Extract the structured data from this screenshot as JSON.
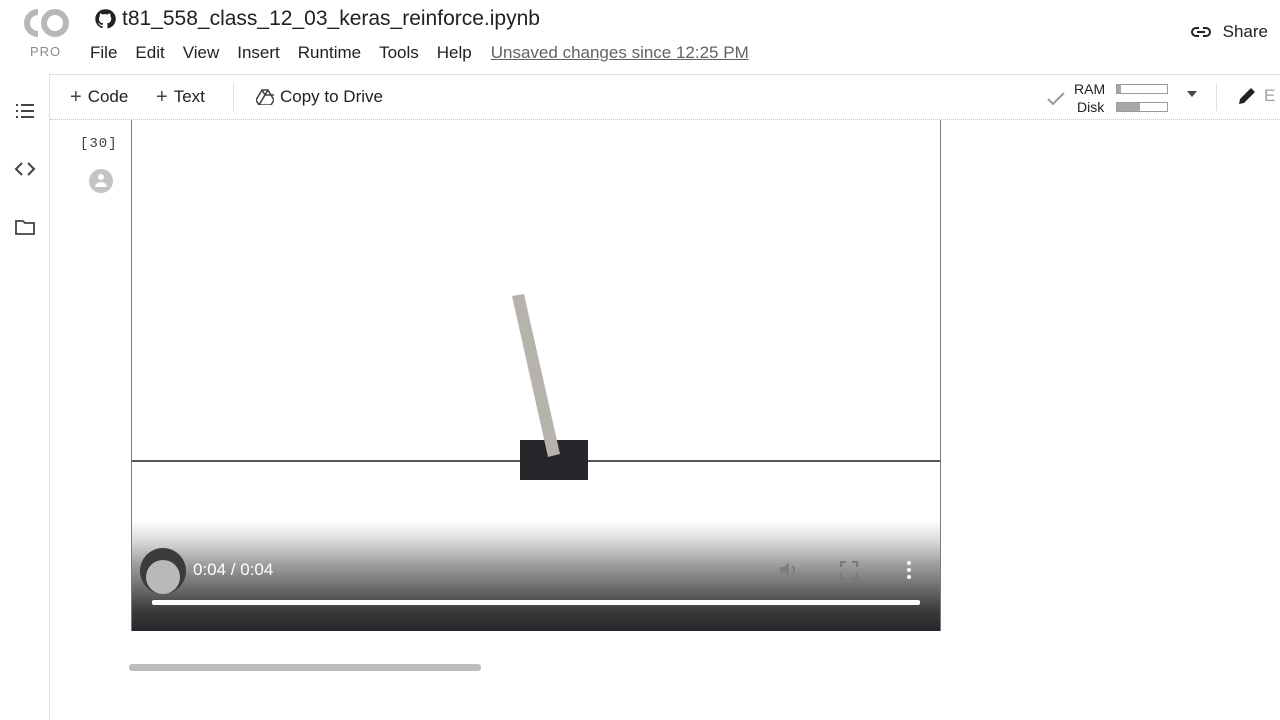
{
  "app": {
    "logo_text": "CO",
    "logo_badge": "PRO",
    "notebook_title": "t81_558_class_12_03_keras_reinforce.ipynb",
    "share_label": "Share"
  },
  "menu": {
    "items": [
      {
        "label": "File"
      },
      {
        "label": "Edit"
      },
      {
        "label": "View"
      },
      {
        "label": "Insert"
      },
      {
        "label": "Runtime"
      },
      {
        "label": "Tools"
      },
      {
        "label": "Help"
      }
    ],
    "unsaved_text": "Unsaved changes since 12:25 PM"
  },
  "toolbar": {
    "code_label": "Code",
    "text_label": "Text",
    "copy_to_drive_label": "Copy to Drive",
    "ram_label": "RAM",
    "disk_label": "Disk",
    "ram_usage": 0.08,
    "disk_usage": 0.45,
    "edit_label": "E"
  },
  "sidebar": {
    "icons": [
      "table-of-contents-icon",
      "code-snippets-icon",
      "files-folder-icon"
    ]
  },
  "cell": {
    "execution_count": "[30]"
  },
  "video": {
    "time_display": "0:04 / 0:04",
    "progress": 1.0,
    "scene": "cartpole",
    "colors": {
      "track": "#1e1e1e",
      "cart": "#27272b",
      "pole": "#b5b3ab",
      "controls_bg": "#27272b"
    }
  }
}
